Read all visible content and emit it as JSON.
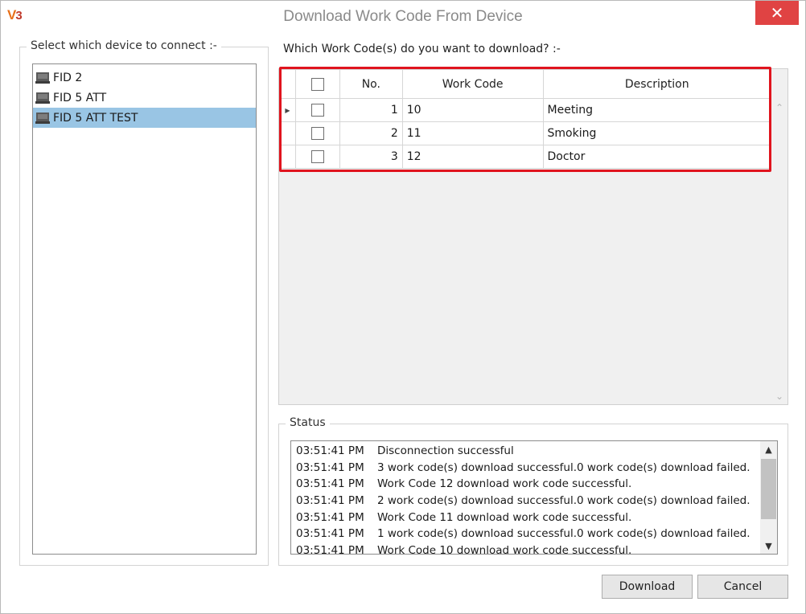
{
  "window": {
    "logo_text": "V3",
    "title": "Download Work Code From Device",
    "close_glyph": "✕"
  },
  "device_panel": {
    "legend": "Select which device to connect :-",
    "devices": [
      {
        "label": "FID 2",
        "selected": false
      },
      {
        "label": "FID 5 ATT",
        "selected": false
      },
      {
        "label": "FID 5 ATT TEST",
        "selected": true
      }
    ]
  },
  "workcodes": {
    "question": "Which Work Code(s) do you want to download? :-",
    "columns": {
      "no": "No.",
      "code": "Work Code",
      "description": "Description"
    },
    "rows": [
      {
        "no": "1",
        "code": "10",
        "description": "Meeting",
        "checked": false,
        "current": true
      },
      {
        "no": "2",
        "code": "11",
        "description": "Smoking",
        "checked": false,
        "current": false
      },
      {
        "no": "3",
        "code": "12",
        "description": "Doctor",
        "checked": false,
        "current": false
      }
    ]
  },
  "status": {
    "legend": "Status",
    "lines": [
      {
        "time": "03:51:41 PM",
        "message": "Disconnection successful"
      },
      {
        "time": "03:51:41 PM",
        "message": "3 work code(s) download successful.0 work code(s) download failed."
      },
      {
        "time": "03:51:41 PM",
        "message": "Work Code 12 download work code successful."
      },
      {
        "time": "03:51:41 PM",
        "message": "2 work code(s) download successful.0 work code(s) download failed."
      },
      {
        "time": "03:51:41 PM",
        "message": "Work Code 11 download work code successful."
      },
      {
        "time": "03:51:41 PM",
        "message": "1 work code(s) download successful.0 work code(s) download failed."
      },
      {
        "time": "03:51:41 PM",
        "message": "Work Code 10 download work code successful."
      }
    ]
  },
  "buttons": {
    "download": "Download",
    "cancel": "Cancel"
  },
  "colors": {
    "accent_close": "#e04343",
    "selection": "#99c5e4",
    "highlight_border": "#e0141e"
  }
}
